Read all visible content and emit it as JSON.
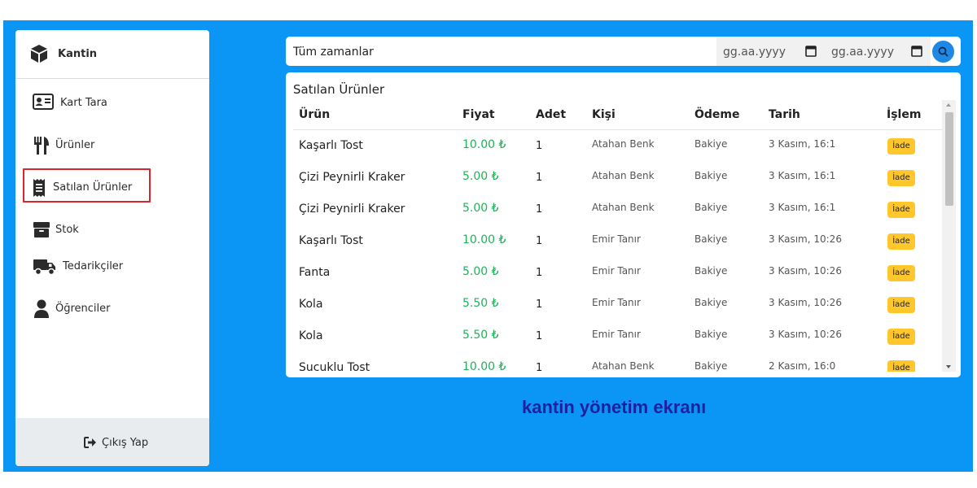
{
  "brand": {
    "name": "Kantin",
    "icon": "cube-icon"
  },
  "sidebar": {
    "items": [
      {
        "label": "Kart Tara",
        "icon": "id-card-icon"
      },
      {
        "label": "Ürünler",
        "icon": "fork-knife-icon"
      },
      {
        "label": "Satılan Ürünler",
        "icon": "receipt-icon",
        "active": true
      },
      {
        "label": "Stok",
        "icon": "box-icon"
      },
      {
        "label": "Tedarikçiler",
        "icon": "truck-icon"
      },
      {
        "label": "Öğrenciler",
        "icon": "user-icon"
      }
    ],
    "logout": {
      "label": "Çıkış Yap",
      "icon": "sign-out-icon"
    }
  },
  "filter": {
    "range": "Tüm zamanlar",
    "start_placeholder": "gg.aa.yyyy",
    "end_placeholder": "gg.aa.yyyy"
  },
  "panel": {
    "title": "Satılan Ürünler",
    "columns": [
      "Ürün",
      "Fiyat",
      "Adet",
      "Kişi",
      "Ödeme",
      "Tarih",
      "İşlem"
    ],
    "rows": [
      {
        "product": "Kaşarlı Tost",
        "price": "10.00 ₺",
        "qty": "1",
        "person": "Atahan Benk",
        "payment": "Bakiye",
        "date": "3 Kasım, 16:1",
        "action": "İade"
      },
      {
        "product": "Çizi Peynirli Kraker",
        "price": "5.00 ₺",
        "qty": "1",
        "person": "Atahan Benk",
        "payment": "Bakiye",
        "date": "3 Kasım, 16:1",
        "action": "İade"
      },
      {
        "product": "Çizi Peynirli Kraker",
        "price": "5.00 ₺",
        "qty": "1",
        "person": "Atahan Benk",
        "payment": "Bakiye",
        "date": "3 Kasım, 16:1",
        "action": "İade"
      },
      {
        "product": "Kaşarlı Tost",
        "price": "10.00 ₺",
        "qty": "1",
        "person": "Emir Tanır",
        "payment": "Bakiye",
        "date": "3 Kasım, 10:26",
        "action": "İade"
      },
      {
        "product": "Fanta",
        "price": "5.00 ₺",
        "qty": "1",
        "person": "Emir Tanır",
        "payment": "Bakiye",
        "date": "3 Kasım, 10:26",
        "action": "İade"
      },
      {
        "product": "Kola",
        "price": "5.50 ₺",
        "qty": "1",
        "person": "Emir Tanır",
        "payment": "Bakiye",
        "date": "3 Kasım, 10:26",
        "action": "İade"
      },
      {
        "product": "Kola",
        "price": "5.50 ₺",
        "qty": "1",
        "person": "Emir Tanır",
        "payment": "Bakiye",
        "date": "3 Kasım, 10:26",
        "action": "İade"
      },
      {
        "product": "Sucuklu Tost",
        "price": "10.00 ₺",
        "qty": "1",
        "person": "Atahan Benk",
        "payment": "Bakiye",
        "date": "2 Kasım, 16:0",
        "action": "İade"
      }
    ]
  },
  "caption": "kantin yönetim ekranı",
  "colors": {
    "background": "#0b96f5",
    "price": "#20b15a",
    "action_badge": "#ffc72c",
    "active_outline": "#d8252e",
    "search_button": "#1e88e5",
    "caption": "#1f1fa0"
  }
}
